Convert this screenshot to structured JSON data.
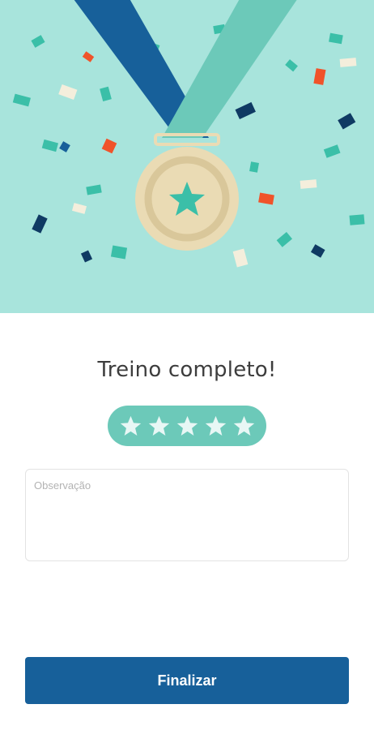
{
  "header": {
    "colors": {
      "background": "#a8e4dc",
      "ribbon_dark": "#17609a",
      "ribbon_light": "#6cc9b9",
      "medal": "#eadbb4",
      "medal_ring": "#d9c79a",
      "confetti": [
        "#3bbfa8",
        "#f4eedc",
        "#17609a",
        "#0f3a63",
        "#f0532a"
      ]
    }
  },
  "main": {
    "title": "Treino completo!",
    "rating": {
      "value": 5,
      "max": 5,
      "pill_color": "#6cc9b9",
      "star_color": "#e8f7f5"
    },
    "note_field": {
      "placeholder": "Observação",
      "value": ""
    }
  },
  "footer": {
    "finish_label": "Finalizar",
    "button_color": "#17609a"
  }
}
